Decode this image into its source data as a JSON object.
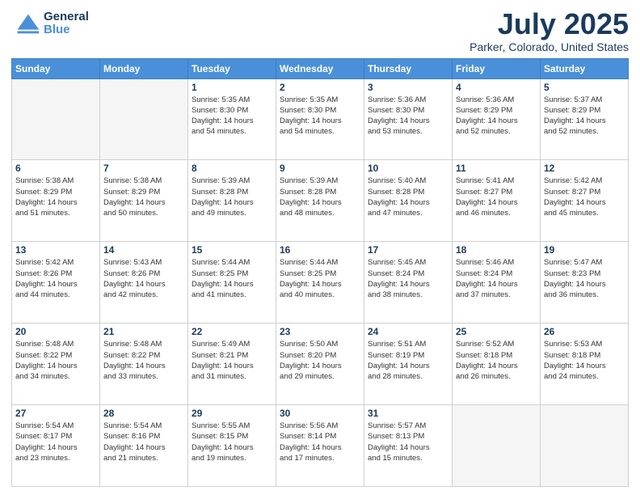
{
  "header": {
    "logo_general": "General",
    "logo_blue": "Blue",
    "month": "July 2025",
    "location": "Parker, Colorado, United States"
  },
  "days_of_week": [
    "Sunday",
    "Monday",
    "Tuesday",
    "Wednesday",
    "Thursday",
    "Friday",
    "Saturday"
  ],
  "weeks": [
    [
      {
        "day": "",
        "info": ""
      },
      {
        "day": "",
        "info": ""
      },
      {
        "day": "1",
        "info": "Sunrise: 5:35 AM\nSunset: 8:30 PM\nDaylight: 14 hours\nand 54 minutes."
      },
      {
        "day": "2",
        "info": "Sunrise: 5:35 AM\nSunset: 8:30 PM\nDaylight: 14 hours\nand 54 minutes."
      },
      {
        "day": "3",
        "info": "Sunrise: 5:36 AM\nSunset: 8:30 PM\nDaylight: 14 hours\nand 53 minutes."
      },
      {
        "day": "4",
        "info": "Sunrise: 5:36 AM\nSunset: 8:29 PM\nDaylight: 14 hours\nand 52 minutes."
      },
      {
        "day": "5",
        "info": "Sunrise: 5:37 AM\nSunset: 8:29 PM\nDaylight: 14 hours\nand 52 minutes."
      }
    ],
    [
      {
        "day": "6",
        "info": "Sunrise: 5:38 AM\nSunset: 8:29 PM\nDaylight: 14 hours\nand 51 minutes."
      },
      {
        "day": "7",
        "info": "Sunrise: 5:38 AM\nSunset: 8:29 PM\nDaylight: 14 hours\nand 50 minutes."
      },
      {
        "day": "8",
        "info": "Sunrise: 5:39 AM\nSunset: 8:28 PM\nDaylight: 14 hours\nand 49 minutes."
      },
      {
        "day": "9",
        "info": "Sunrise: 5:39 AM\nSunset: 8:28 PM\nDaylight: 14 hours\nand 48 minutes."
      },
      {
        "day": "10",
        "info": "Sunrise: 5:40 AM\nSunset: 8:28 PM\nDaylight: 14 hours\nand 47 minutes."
      },
      {
        "day": "11",
        "info": "Sunrise: 5:41 AM\nSunset: 8:27 PM\nDaylight: 14 hours\nand 46 minutes."
      },
      {
        "day": "12",
        "info": "Sunrise: 5:42 AM\nSunset: 8:27 PM\nDaylight: 14 hours\nand 45 minutes."
      }
    ],
    [
      {
        "day": "13",
        "info": "Sunrise: 5:42 AM\nSunset: 8:26 PM\nDaylight: 14 hours\nand 44 minutes."
      },
      {
        "day": "14",
        "info": "Sunrise: 5:43 AM\nSunset: 8:26 PM\nDaylight: 14 hours\nand 42 minutes."
      },
      {
        "day": "15",
        "info": "Sunrise: 5:44 AM\nSunset: 8:25 PM\nDaylight: 14 hours\nand 41 minutes."
      },
      {
        "day": "16",
        "info": "Sunrise: 5:44 AM\nSunset: 8:25 PM\nDaylight: 14 hours\nand 40 minutes."
      },
      {
        "day": "17",
        "info": "Sunrise: 5:45 AM\nSunset: 8:24 PM\nDaylight: 14 hours\nand 38 minutes."
      },
      {
        "day": "18",
        "info": "Sunrise: 5:46 AM\nSunset: 8:24 PM\nDaylight: 14 hours\nand 37 minutes."
      },
      {
        "day": "19",
        "info": "Sunrise: 5:47 AM\nSunset: 8:23 PM\nDaylight: 14 hours\nand 36 minutes."
      }
    ],
    [
      {
        "day": "20",
        "info": "Sunrise: 5:48 AM\nSunset: 8:22 PM\nDaylight: 14 hours\nand 34 minutes."
      },
      {
        "day": "21",
        "info": "Sunrise: 5:48 AM\nSunset: 8:22 PM\nDaylight: 14 hours\nand 33 minutes."
      },
      {
        "day": "22",
        "info": "Sunrise: 5:49 AM\nSunset: 8:21 PM\nDaylight: 14 hours\nand 31 minutes."
      },
      {
        "day": "23",
        "info": "Sunrise: 5:50 AM\nSunset: 8:20 PM\nDaylight: 14 hours\nand 29 minutes."
      },
      {
        "day": "24",
        "info": "Sunrise: 5:51 AM\nSunset: 8:19 PM\nDaylight: 14 hours\nand 28 minutes."
      },
      {
        "day": "25",
        "info": "Sunrise: 5:52 AM\nSunset: 8:18 PM\nDaylight: 14 hours\nand 26 minutes."
      },
      {
        "day": "26",
        "info": "Sunrise: 5:53 AM\nSunset: 8:18 PM\nDaylight: 14 hours\nand 24 minutes."
      }
    ],
    [
      {
        "day": "27",
        "info": "Sunrise: 5:54 AM\nSunset: 8:17 PM\nDaylight: 14 hours\nand 23 minutes."
      },
      {
        "day": "28",
        "info": "Sunrise: 5:54 AM\nSunset: 8:16 PM\nDaylight: 14 hours\nand 21 minutes."
      },
      {
        "day": "29",
        "info": "Sunrise: 5:55 AM\nSunset: 8:15 PM\nDaylight: 14 hours\nand 19 minutes."
      },
      {
        "day": "30",
        "info": "Sunrise: 5:56 AM\nSunset: 8:14 PM\nDaylight: 14 hours\nand 17 minutes."
      },
      {
        "day": "31",
        "info": "Sunrise: 5:57 AM\nSunset: 8:13 PM\nDaylight: 14 hours\nand 15 minutes."
      },
      {
        "day": "",
        "info": ""
      },
      {
        "day": "",
        "info": ""
      }
    ]
  ]
}
